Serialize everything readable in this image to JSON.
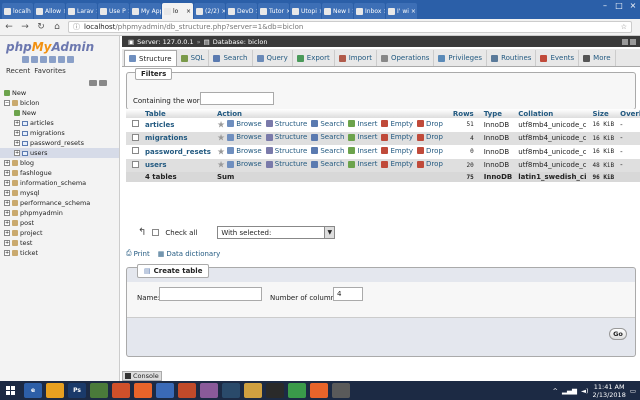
{
  "browser": {
    "tabs": [
      {
        "label": "localh",
        "active": false
      },
      {
        "label": "Allow",
        "active": false
      },
      {
        "label": "Larav",
        "active": false
      },
      {
        "label": "Use P",
        "active": false
      },
      {
        "label": "My Applic",
        "active": false
      },
      {
        "label": "lo",
        "active": true
      },
      {
        "label": "(2/2)",
        "active": false
      },
      {
        "label": "DevD",
        "active": false
      },
      {
        "label": "Tutor",
        "active": false
      },
      {
        "label": "Utopi",
        "active": false
      },
      {
        "label": "New I",
        "active": false
      },
      {
        "label": "Inbox",
        "active": false
      },
      {
        "label": "I' wi",
        "active": false
      }
    ],
    "url_host": "localhost",
    "url_path": "/phpmyadmin/db_structure.php?server=1&db=biclon"
  },
  "nav": {
    "logo": {
      "php": "php",
      "my": "My",
      "admin": "Admin"
    },
    "tabs": [
      "Recent",
      "Favorites"
    ],
    "tree": [
      {
        "label": "New",
        "level": 0,
        "type": "new"
      },
      {
        "label": "biclon",
        "level": 0,
        "type": "db",
        "expanded": true
      },
      {
        "label": "New",
        "level": 1,
        "type": "new"
      },
      {
        "label": "articles",
        "level": 1,
        "type": "table"
      },
      {
        "label": "migrations",
        "level": 1,
        "type": "table"
      },
      {
        "label": "password_resets",
        "level": 1,
        "type": "table"
      },
      {
        "label": "users",
        "level": 1,
        "type": "table"
      },
      {
        "label": "blog",
        "level": 0,
        "type": "db"
      },
      {
        "label": "fashlogue",
        "level": 0,
        "type": "db"
      },
      {
        "label": "information_schema",
        "level": 0,
        "type": "db"
      },
      {
        "label": "mysql",
        "level": 0,
        "type": "db"
      },
      {
        "label": "performance_schema",
        "level": 0,
        "type": "db"
      },
      {
        "label": "phpmyadmin",
        "level": 0,
        "type": "db"
      },
      {
        "label": "post",
        "level": 0,
        "type": "db"
      },
      {
        "label": "project",
        "level": 0,
        "type": "db"
      },
      {
        "label": "test",
        "level": 0,
        "type": "db"
      },
      {
        "label": "ticket",
        "level": 0,
        "type": "db"
      }
    ]
  },
  "breadcrumb": {
    "server": "Server: 127.0.0.1",
    "database": "Database: biclon"
  },
  "menu": [
    {
      "label": "Structure",
      "active": true,
      "color": "#6f8fbf"
    },
    {
      "label": "SQL",
      "active": false,
      "color": "#7a9a4a"
    },
    {
      "label": "Search",
      "active": false,
      "color": "#5a7ab0"
    },
    {
      "label": "Query",
      "active": false,
      "color": "#6a8ab8"
    },
    {
      "label": "Export",
      "active": false,
      "color": "#4a9a5a"
    },
    {
      "label": "Import",
      "active": false,
      "color": "#b05a4a"
    },
    {
      "label": "Operations",
      "active": false,
      "color": "#888888"
    },
    {
      "label": "Privileges",
      "active": false,
      "color": "#5a8ab8"
    },
    {
      "label": "Routines",
      "active": false,
      "color": "#5a7a9a"
    },
    {
      "label": "Events",
      "active": false,
      "color": "#c04a3a"
    },
    {
      "label": "More",
      "active": false,
      "color": "#555555"
    }
  ],
  "filters": {
    "legend": "Filters",
    "label": "Containing the word:",
    "value": ""
  },
  "table": {
    "headers": {
      "table": "Table",
      "action": "Action",
      "rows": "Rows",
      "type": "Type",
      "collation": "Collation",
      "size": "Size",
      "overhead": "Overhead"
    },
    "actions": [
      "Browse",
      "Structure",
      "Search",
      "Insert",
      "Empty",
      "Drop"
    ],
    "rows": [
      {
        "name": "articles",
        "rows": "51",
        "type": "InnoDB",
        "collation": "utf8mb4_unicode_ci",
        "size": "16 KiB",
        "overhead": "-"
      },
      {
        "name": "migrations",
        "rows": "4",
        "type": "InnoDB",
        "collation": "utf8mb4_unicode_ci",
        "size": "16 KiB",
        "overhead": "-"
      },
      {
        "name": "password_resets",
        "rows": "0",
        "type": "InnoDB",
        "collation": "utf8mb4_unicode_ci",
        "size": "16 KiB",
        "overhead": "-"
      },
      {
        "name": "users",
        "rows": "20",
        "type": "InnoDB",
        "collation": "utf8mb4_unicode_ci",
        "size": "48 KiB",
        "overhead": "-"
      }
    ],
    "sum": {
      "name": "4 tables",
      "label": "Sum",
      "rows": "75",
      "type": "InnoDB",
      "collation": "latin1_swedish_ci",
      "size": "96 KiB",
      "overhead": "0 B"
    }
  },
  "bulk": {
    "check_all": "Check all",
    "with_selected": "With selected:"
  },
  "links": {
    "print": "Print",
    "data_dictionary": "Data dictionary"
  },
  "create_table": {
    "legend": "Create table",
    "name_label": "Name:",
    "name_value": "",
    "columns_label": "Number of columns:",
    "columns_value": "4",
    "go": "Go"
  },
  "console": "Console",
  "taskbar": {
    "apps": [
      {
        "label": "e",
        "color": "#2d5fa8"
      },
      {
        "label": "",
        "color": "#e8a020"
      },
      {
        "label": "Ps",
        "color": "#1a3a6a"
      },
      {
        "label": "",
        "color": "#4a7a3a"
      },
      {
        "label": "",
        "color": "#d0502a"
      },
      {
        "label": "",
        "color": "#e8642a"
      },
      {
        "label": "",
        "color": "#3a6ab8"
      },
      {
        "label": "",
        "color": "#c04a2a"
      },
      {
        "label": "",
        "color": "#8a5a9a"
      },
      {
        "label": "",
        "color": "#2a4a6a"
      },
      {
        "label": "",
        "color": "#d0a040"
      },
      {
        "label": "",
        "color": "#2a2a2a"
      },
      {
        "label": "",
        "color": "#3a9a4a"
      },
      {
        "label": "",
        "color": "#e8642a"
      },
      {
        "label": "",
        "color": "#5a5a5a"
      }
    ],
    "time": "11:41 AM",
    "date": "2/13/2018"
  }
}
